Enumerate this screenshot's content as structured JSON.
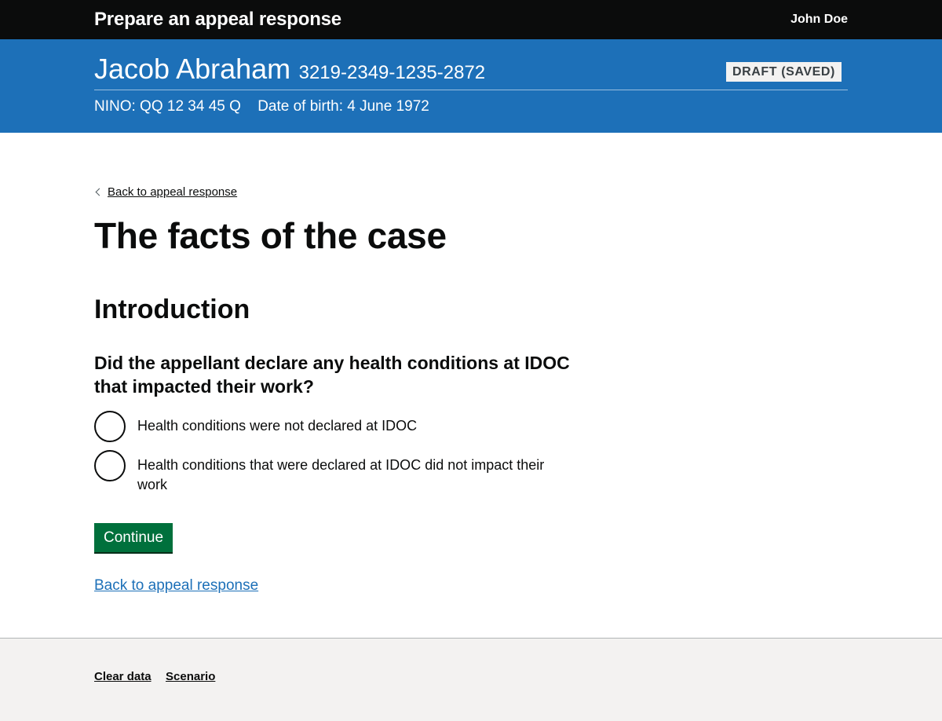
{
  "header": {
    "service_name": "Prepare an appeal response",
    "user_name": "John Doe"
  },
  "case": {
    "name": "Jacob Abraham",
    "reference": "3219-2349-1235-2872",
    "status": "DRAFT (SAVED)",
    "nino": "NINO: QQ 12 34 45 Q",
    "dob": "Date of birth: 4 June 1972"
  },
  "main": {
    "back_link": "Back to appeal response",
    "title": "The facts of the case",
    "section_heading": "Introduction",
    "question": "Did the appellant declare any health conditions at IDOC that impacted their work?",
    "options": [
      {
        "label": "Health conditions were not declared at IDOC"
      },
      {
        "label": "Health conditions that were declared at IDOC did not impact their work"
      }
    ],
    "continue_label": "Continue",
    "bottom_link": "Back to appeal response"
  },
  "footer": {
    "links": [
      "Clear data",
      "Scenario"
    ]
  },
  "colors": {
    "header_bg": "#0b0c0c",
    "banner_bg": "#1d70b8",
    "button_green": "#00703c",
    "link_blue": "#1d70b8",
    "footer_bg": "#f3f2f1"
  }
}
